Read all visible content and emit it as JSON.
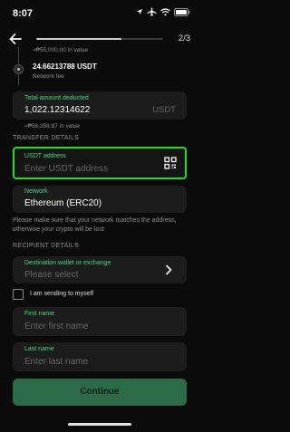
{
  "status_bar": {
    "time": "8:07",
    "icons": [
      "location-arrow-icon",
      "airplane-icon",
      "wifi-icon",
      "battery-icon"
    ]
  },
  "nav": {
    "step_counter": "2/3",
    "progress": 0.67
  },
  "fee": {
    "value_text": "≈₱55,000.00 in value",
    "amount": "24.66213788 USDT",
    "label": "Network fee"
  },
  "total": {
    "label": "Total amount deducted",
    "value": "1,022.12314622",
    "unit": "USDT",
    "sub_value": "≈₱56,358.87 in value"
  },
  "transfer_details": {
    "section_title": "TRANSFER DETAILS",
    "usdt_address": {
      "label": "USDT address",
      "placeholder": "Enter USDT address"
    },
    "network": {
      "label": "Network",
      "value": "Ethereum (ERC20)"
    },
    "note": "Please make sure that your network matches the address, otherwise your crypto will be lost"
  },
  "recipient_details": {
    "section_title": "RECIPIENT DETAILS",
    "destination": {
      "label": "Destination wallet or exchange",
      "placeholder": "Please select"
    },
    "self_checkbox_label": "I am sending to myself",
    "first_name": {
      "label": "First name",
      "placeholder": "Enter first name"
    },
    "last_name": {
      "label": "Last name",
      "placeholder": "Enter last name"
    }
  },
  "continue_label": "Continue",
  "colors": {
    "accent": "#3ad67f",
    "highlight": "#22dd22",
    "background": "#0b0b0b",
    "card": "#1c1c1c",
    "button": "#2b6b47"
  }
}
